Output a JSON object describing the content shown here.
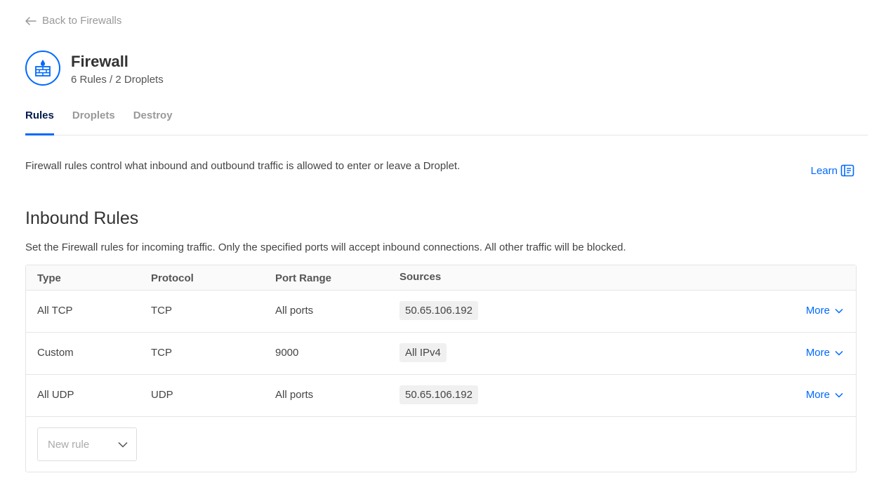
{
  "nav": {
    "back_label": "Back to Firewalls"
  },
  "header": {
    "title": "Firewall",
    "subtitle": "6 Rules / 2 Droplets",
    "icon": "firewall-icon"
  },
  "tabs": [
    {
      "label": "Rules",
      "active": true
    },
    {
      "label": "Droplets",
      "active": false
    },
    {
      "label": "Destroy",
      "active": false
    }
  ],
  "intro": {
    "text": "Firewall rules control what inbound and outbound traffic is allowed to enter or leave a Droplet.",
    "learn_label": "Learn"
  },
  "inbound": {
    "title": "Inbound Rules",
    "description": "Set the Firewall rules for incoming traffic. Only the specified ports will accept inbound connections. All other traffic will be blocked.",
    "columns": [
      "Type",
      "Protocol",
      "Port Range",
      "Sources"
    ],
    "rows": [
      {
        "type": "All TCP",
        "protocol": "TCP",
        "port_range": "All ports",
        "source": "50.65.106.192",
        "more_label": "More"
      },
      {
        "type": "Custom",
        "protocol": "TCP",
        "port_range": "9000",
        "source": "All IPv4",
        "more_label": "More"
      },
      {
        "type": "All UDP",
        "protocol": "UDP",
        "port_range": "All ports",
        "source": "50.65.106.192",
        "more_label": "More"
      }
    ],
    "new_rule_placeholder": "New rule"
  },
  "colors": {
    "accent": "#0069ff",
    "heading": "#031b4e",
    "muted": "#999999"
  }
}
